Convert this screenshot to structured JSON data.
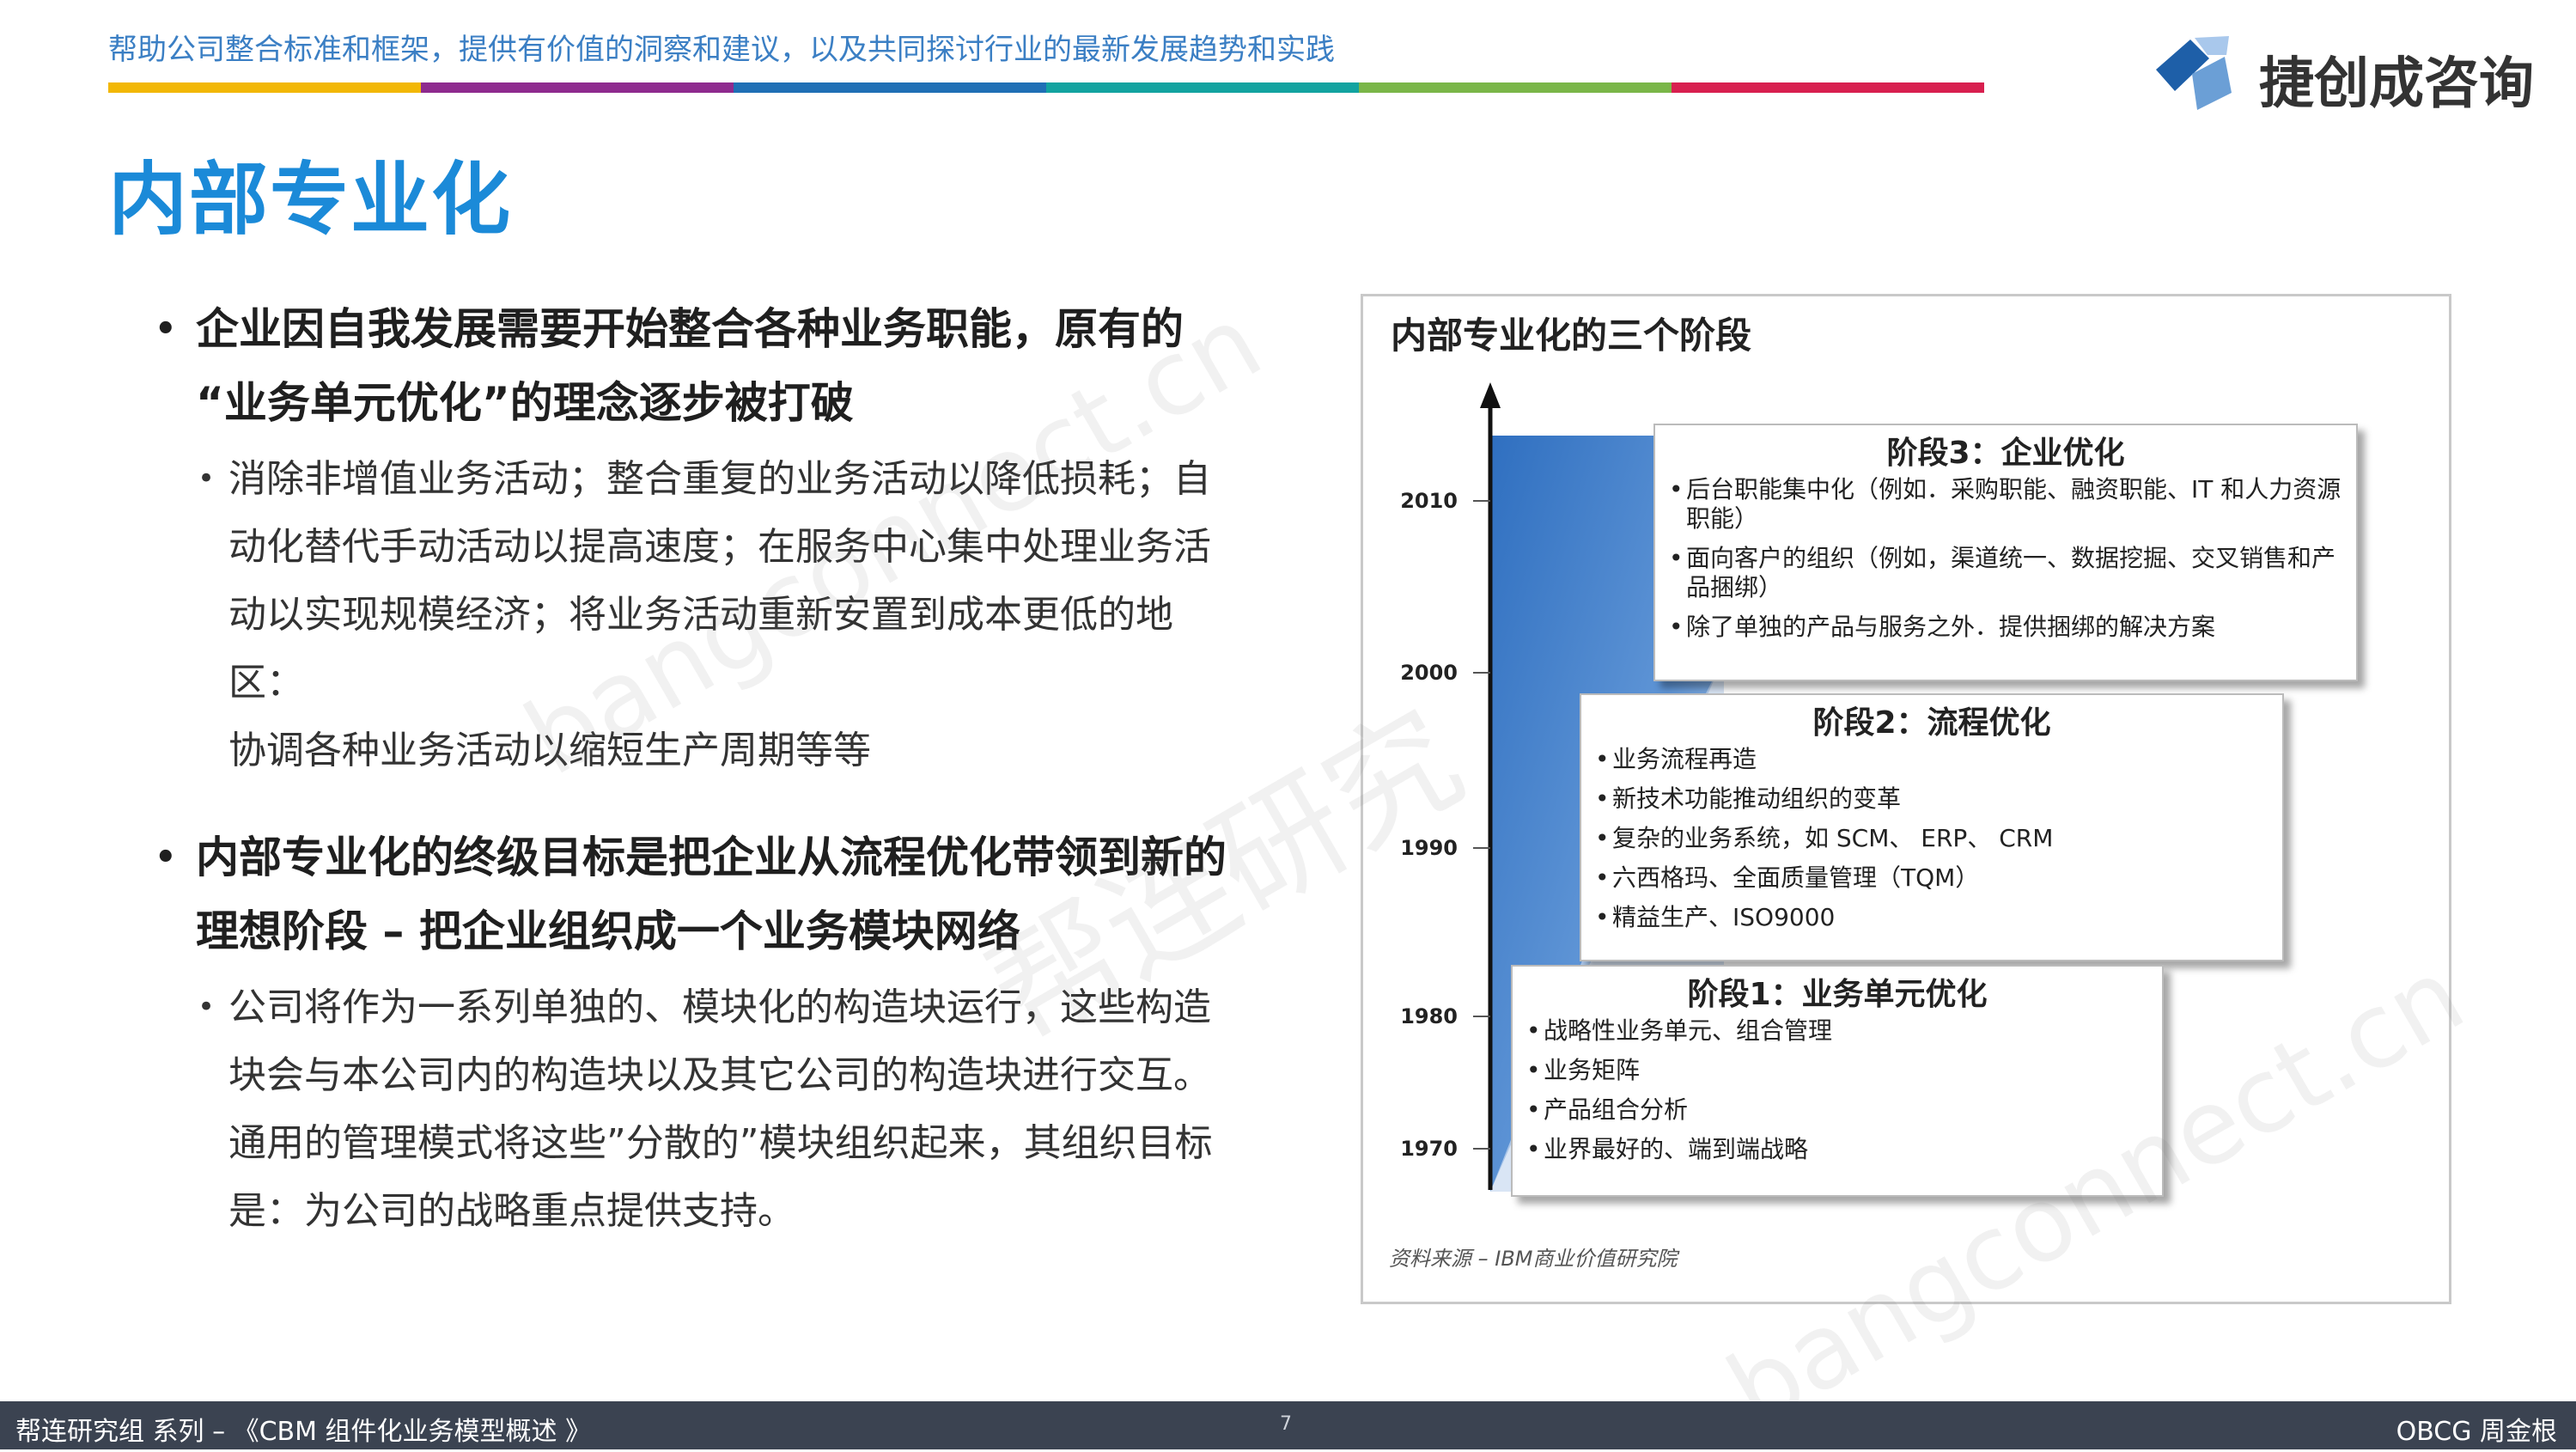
{
  "header": {
    "tagline": "帮助公司整合标准和框架，提供有价值的洞察和建议，以及共同探讨行业的最新发展趋势和实践",
    "color_bar": [
      "#f2b705",
      "#8e2a8e",
      "#1f6fb5",
      "#12a3a0",
      "#7ab648",
      "#d81f4f"
    ],
    "logo_text": "捷创成咨询",
    "logo_colors": [
      "#1e5fa8",
      "#6b9fd6",
      "#a9c8ec"
    ]
  },
  "title": "内部专业化",
  "bullets": [
    {
      "text_lines": [
        "企业因自我发展需要开始整合各种业务职能，原有的",
        "“业务单元优化”的理念逐步被打破"
      ],
      "sub": {
        "text_lines": [
          "消除非增值业务活动；整合重复的业务活动以降低损耗；自",
          "动化替代手动活动以提高速度；在服务中心集中处理业务活",
          "动以实现规模经济；将业务活动重新安置到成本更低的地区：",
          "协调各种业务活动以缩短生产周期等等"
        ]
      }
    },
    {
      "text_lines": [
        "内部专业化的终级目标是把企业从流程优化带领到新的",
        "理想阶段 – 把企业组织成一个业务模块网络"
      ],
      "sub": {
        "text_lines": [
          "公司将作为一系列单独的、模块化的构造块运行，这些构造",
          "块会与本公司内的构造块以及其它公司的构造块进行交互。",
          "通用的管理模式将这些”分散的”模块组织起来，其组织目标",
          "是：为公司的战略重点提供支持。"
        ]
      }
    }
  ],
  "figure": {
    "title": "内部专业化的三个阶段",
    "years": [
      "2010",
      "2000",
      "1990",
      "1980",
      "1970"
    ],
    "stages": [
      {
        "title": "阶段3：企业优化",
        "items": [
          "后台职能集中化（例如．采购职能、融资职能、IT 和人力资源职能）",
          "面向客户的组织（例如，渠道统一、数据挖掘、交叉销售和产品捆绑）",
          "除了单独的产品与服务之外．提供捆绑的解决方案"
        ]
      },
      {
        "title": "阶段2：流程优化",
        "items": [
          "业务流程再造",
          "新技术功能推动组织的变革",
          "复杂的业务系统，如 SCM、 ERP、 CRM",
          "六西格玛、全面质量管理（TQM）",
          "精益生产、ISO9000"
        ]
      },
      {
        "title": "阶段1：业务单元优化",
        "items": [
          "战略性业务单元、组合管理",
          "业务矩阵",
          "产品组合分析",
          "业界最好的、端到端战略"
        ]
      }
    ],
    "source": "资料来源 – IBM商业价值研究院",
    "accent": "#2f6fc0"
  },
  "footer": {
    "left": "帮连研究组 系列 – 《CBM 组件化业务模型概述 》",
    "page": "7",
    "right": "OBCG 周金根"
  },
  "watermark": {
    "text_1": "bangconnect.cn",
    "text_2": "帮连研究",
    "text_3": "bangconnect.cn"
  }
}
